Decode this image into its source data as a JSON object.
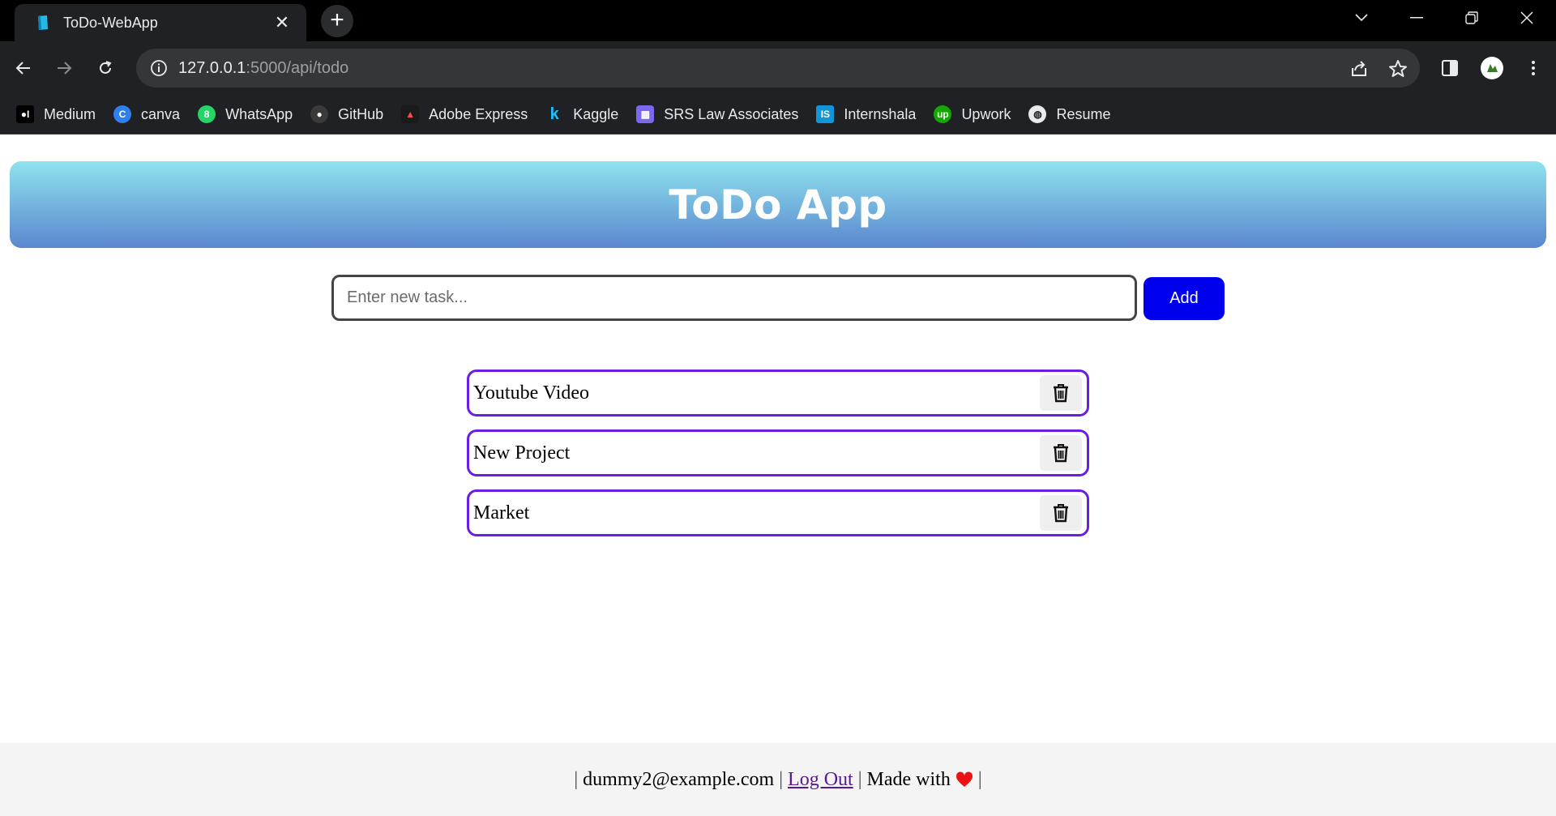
{
  "browser": {
    "tab_title": "ToDo-WebApp",
    "url_host": "127.0.0.1",
    "url_path": ":5000/api/todo",
    "bookmarks": [
      {
        "label": "Medium",
        "icon": "medium-icon",
        "color": "#000000"
      },
      {
        "label": "canva",
        "icon": "canva-icon",
        "color": "#2f80ed"
      },
      {
        "label": "WhatsApp",
        "icon": "whatsapp-icon",
        "color": "#25d366"
      },
      {
        "label": "GitHub",
        "icon": "github-icon",
        "color": "#3a3a3a"
      },
      {
        "label": "Adobe Express",
        "icon": "adobe-express-icon",
        "color": "#1a1a1a"
      },
      {
        "label": "Kaggle",
        "icon": "kaggle-icon",
        "color": "#20beff"
      },
      {
        "label": "SRS Law Associates",
        "icon": "calendar-icon",
        "color": "#7b68ee"
      },
      {
        "label": "Internshala",
        "icon": "internshala-icon",
        "color": "#1295d8"
      },
      {
        "label": "Upwork",
        "icon": "upwork-icon",
        "color": "#14a800"
      },
      {
        "label": "Resume",
        "icon": "globe-icon",
        "color": "#e8eaed"
      }
    ]
  },
  "app": {
    "title": "ToDo App",
    "input_placeholder": "Enter new task...",
    "add_label": "Add",
    "todos": [
      {
        "text": "Youtube Video"
      },
      {
        "text": "New Project"
      },
      {
        "text": "Market"
      }
    ]
  },
  "footer": {
    "email": "dummy2@example.com",
    "logout": "Log Out",
    "made_with": "Made with",
    "heart_color": "#ee1111"
  },
  "colors": {
    "accent": "#0000ee",
    "todo_border": "#6a1de4"
  }
}
